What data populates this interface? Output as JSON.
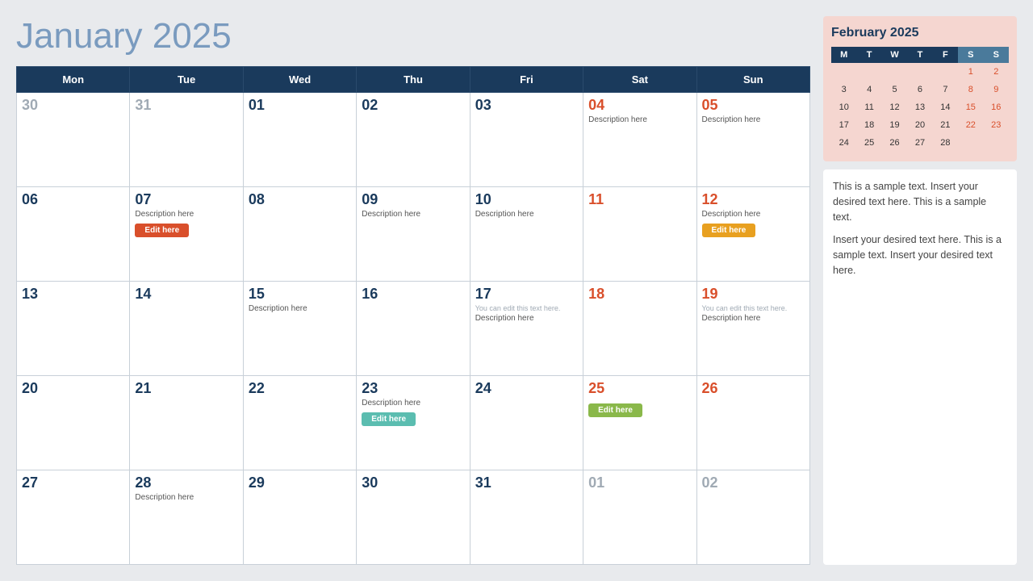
{
  "title": {
    "month": "January",
    "year": "2025"
  },
  "header": {
    "days": [
      "Mon",
      "Tue",
      "Wed",
      "Thu",
      "Fri",
      "Sat",
      "Sun"
    ]
  },
  "weeks": [
    [
      {
        "num": "30",
        "type": "muted",
        "desc": "",
        "note": "",
        "btn": null
      },
      {
        "num": "31",
        "type": "muted",
        "desc": "",
        "note": "",
        "btn": null
      },
      {
        "num": "01",
        "type": "normal",
        "desc": "",
        "note": "",
        "btn": null
      },
      {
        "num": "02",
        "type": "normal",
        "desc": "",
        "note": "",
        "btn": null
      },
      {
        "num": "03",
        "type": "normal",
        "desc": "",
        "note": "",
        "btn": null
      },
      {
        "num": "04",
        "type": "weekend",
        "desc": "Description here",
        "note": "",
        "btn": null
      },
      {
        "num": "05",
        "type": "weekend",
        "desc": "Description here",
        "note": "",
        "btn": null
      }
    ],
    [
      {
        "num": "06",
        "type": "normal",
        "desc": "",
        "note": "",
        "btn": null
      },
      {
        "num": "07",
        "type": "normal",
        "desc": "Description here",
        "note": "",
        "btn": {
          "label": "Edit here",
          "color": "btn-red"
        }
      },
      {
        "num": "08",
        "type": "normal",
        "desc": "",
        "note": "",
        "btn": null
      },
      {
        "num": "09",
        "type": "normal",
        "desc": "Description here",
        "note": "",
        "btn": null
      },
      {
        "num": "10",
        "type": "normal",
        "desc": "Description here",
        "note": "",
        "btn": null
      },
      {
        "num": "11",
        "type": "weekend",
        "desc": "",
        "note": "",
        "btn": null
      },
      {
        "num": "12",
        "type": "weekend",
        "desc": "Description here",
        "note": "",
        "btn": {
          "label": "Edit here",
          "color": "btn-orange"
        }
      }
    ],
    [
      {
        "num": "13",
        "type": "normal",
        "desc": "",
        "note": "",
        "btn": null
      },
      {
        "num": "14",
        "type": "normal",
        "desc": "",
        "note": "",
        "btn": null
      },
      {
        "num": "15",
        "type": "normal",
        "desc": "Description here",
        "note": "",
        "btn": null
      },
      {
        "num": "16",
        "type": "normal",
        "desc": "",
        "note": "",
        "btn": null
      },
      {
        "num": "17",
        "type": "normal",
        "desc": "Description here",
        "note": "You can edit this text here.",
        "btn": null
      },
      {
        "num": "18",
        "type": "weekend",
        "desc": "",
        "note": "",
        "btn": null
      },
      {
        "num": "19",
        "type": "weekend",
        "desc": "Description here",
        "note": "You can edit this text here.",
        "btn": null
      }
    ],
    [
      {
        "num": "20",
        "type": "normal",
        "desc": "",
        "note": "",
        "btn": null
      },
      {
        "num": "21",
        "type": "normal",
        "desc": "",
        "note": "",
        "btn": null
      },
      {
        "num": "22",
        "type": "normal",
        "desc": "",
        "note": "",
        "btn": null
      },
      {
        "num": "23",
        "type": "normal",
        "desc": "Description here",
        "note": "",
        "btn": {
          "label": "Edit here",
          "color": "btn-teal"
        }
      },
      {
        "num": "24",
        "type": "normal",
        "desc": "",
        "note": "",
        "btn": null
      },
      {
        "num": "25",
        "type": "weekend",
        "desc": "",
        "note": "",
        "btn": {
          "label": "Edit here",
          "color": "btn-green"
        }
      },
      {
        "num": "26",
        "type": "weekend",
        "desc": "",
        "note": "",
        "btn": null
      }
    ],
    [
      {
        "num": "27",
        "type": "normal",
        "desc": "",
        "note": "",
        "btn": null
      },
      {
        "num": "28",
        "type": "normal",
        "desc": "Description here",
        "note": "",
        "btn": null
      },
      {
        "num": "29",
        "type": "normal",
        "desc": "",
        "note": "",
        "btn": null
      },
      {
        "num": "30",
        "type": "normal",
        "desc": "",
        "note": "",
        "btn": null
      },
      {
        "num": "31",
        "type": "normal",
        "desc": "",
        "note": "",
        "btn": null
      },
      {
        "num": "01",
        "type": "muted",
        "desc": "",
        "note": "",
        "btn": null
      },
      {
        "num": "02",
        "type": "muted",
        "desc": "",
        "note": "",
        "btn": null
      }
    ]
  ],
  "mini_cal": {
    "title": "February 2025",
    "headers": [
      "M",
      "T",
      "W",
      "T",
      "F",
      "S",
      "S"
    ],
    "weeks": [
      [
        null,
        null,
        null,
        null,
        null,
        "1",
        "2"
      ],
      [
        "3",
        "4",
        "5",
        "6",
        "7",
        "8",
        "9"
      ],
      [
        "10",
        "11",
        "12",
        "13",
        "14",
        "15",
        "16"
      ],
      [
        "17",
        "18",
        "19",
        "20",
        "21",
        "22",
        "23"
      ],
      [
        "24",
        "25",
        "26",
        "27",
        "28",
        null,
        null
      ]
    ]
  },
  "notes": {
    "para1": "This is a sample text. Insert your desired text here. This is a sample text.",
    "para2": "Insert your desired text here. This is a sample text. Insert your desired text here."
  }
}
